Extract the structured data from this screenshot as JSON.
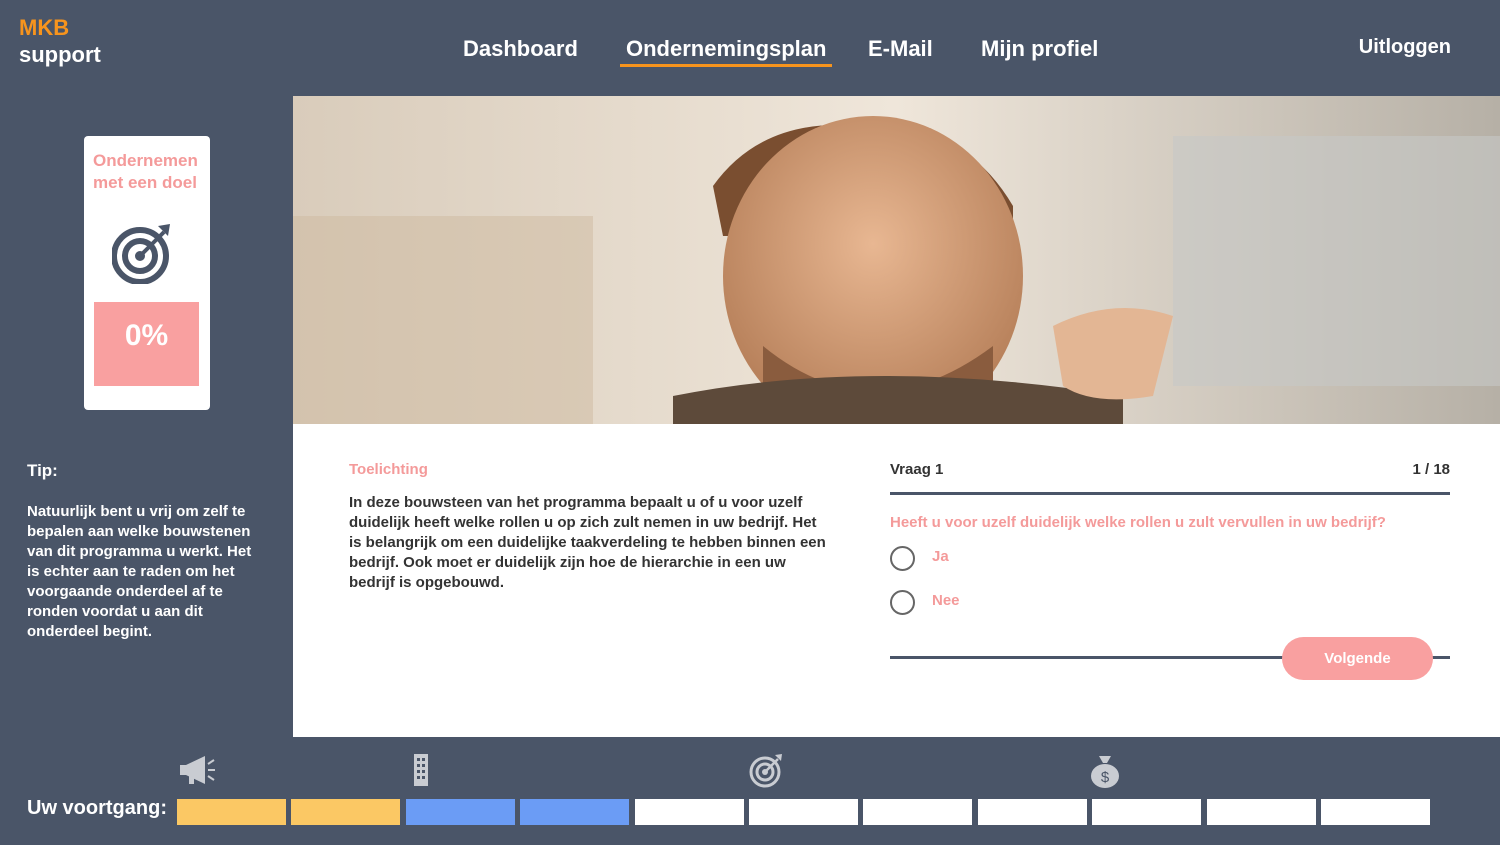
{
  "header": {
    "logo_line1": "MKB",
    "logo_line2": "support",
    "nav": [
      "Dashboard",
      "Ondernemingsplan",
      "E-Mail",
      "Mijn profiel"
    ],
    "active_nav": "Ondernemingsplan",
    "logout": "Uitloggen"
  },
  "sidebar": {
    "card_title": "Ondernemen met een doel",
    "card_icon": "target-icon",
    "progress_percent": "0%",
    "tip_heading": "Tip:",
    "tip_text": "Natuurlijk bent u vrij om zelf te bepalen aan welke bouwstenen van dit programma u werkt. Het is echter aan te raden om het voorgaande onderdeel af te ronden voordat u aan dit onderdeel begint."
  },
  "hero": {
    "image": "photo of man looking upward with raised fist"
  },
  "explanation": {
    "heading": "Toelichting",
    "text": "In deze bouwsteen van het programma bepaalt u of u voor uzelf duidelijk heeft welke rollen u op zich zult nemen in uw bedrijf. Het is belangrijk om een duidelijke taakverdeling te hebben binnen een bedrijf. Ook moet er duidelijk zijn hoe de hierarchie in een uw bedrijf is opgebouwd."
  },
  "question": {
    "label": "Vraag 1",
    "counter": "1 / 18",
    "text": "Heeft u voor uzelf duidelijk welke rollen u zult vervullen in uw bedrijf?",
    "options": [
      "Ja",
      "Nee"
    ],
    "next_button": "Volgende"
  },
  "progress": {
    "label": "Uw voortgang:",
    "icons": [
      "megaphone-icon",
      "building-icon",
      "target-icon",
      "money-bag-icon"
    ],
    "segments": [
      "done",
      "done",
      "current",
      "current",
      "todo",
      "todo",
      "todo",
      "todo",
      "todo",
      "todo",
      "todo"
    ]
  },
  "colors": {
    "background": "#4a5568",
    "accent_orange": "#f7941d",
    "accent_pink": "#f9a0a0",
    "segment_done": "#fbc864",
    "segment_current": "#6b9cf5",
    "segment_todo": "#ffffff"
  }
}
